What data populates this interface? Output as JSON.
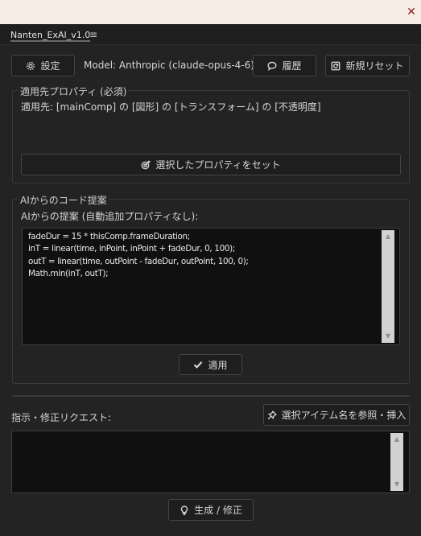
{
  "window": {
    "close_glyph": "✕"
  },
  "panel": {
    "title": "Nanten_ExAI_v1.0",
    "menu_glyph": "≡"
  },
  "toolbar": {
    "settings_label": "設定",
    "model_label": "Model: Anthropic (claude-opus-4-6)",
    "history_label": "履歴",
    "new_reset_label": "新規リセット"
  },
  "target": {
    "group_title": "適用先プロパティ (必須)",
    "path_text": "適用先: [mainComp] の [図形] の [トランスフォーム] の [不透明度]",
    "set_button_label": "選択したプロパティをセット"
  },
  "ai": {
    "group_title": "AIからのコード提案",
    "subtitle": "AIからの提案 (自動追加プロパティなし):",
    "code": [
      "fadeDur = 15 * thisComp.frameDuration;",
      "inT = linear(time, inPoint, inPoint + fadeDur, 0, 100);",
      "outT = linear(time, outPoint - fadeDur, outPoint, 100, 0);",
      "Math.min(inT, outT);"
    ],
    "apply_label": "適用"
  },
  "request": {
    "label": "指示・修正リクエスト:",
    "insert_button_label": "選択アイテム名を参照・挿入",
    "value": "",
    "generate_label": "生成 / 修正"
  },
  "scrollbar": {
    "up_glyph": "▲",
    "down_glyph": "▼"
  },
  "icons": {
    "settings": "gear-icon",
    "history": "speech-bubble-icon",
    "new_reset": "refresh-icon",
    "set_property": "target-icon",
    "apply": "checkmark-icon",
    "insert": "pin-icon",
    "generate": "lightbulb-icon"
  }
}
